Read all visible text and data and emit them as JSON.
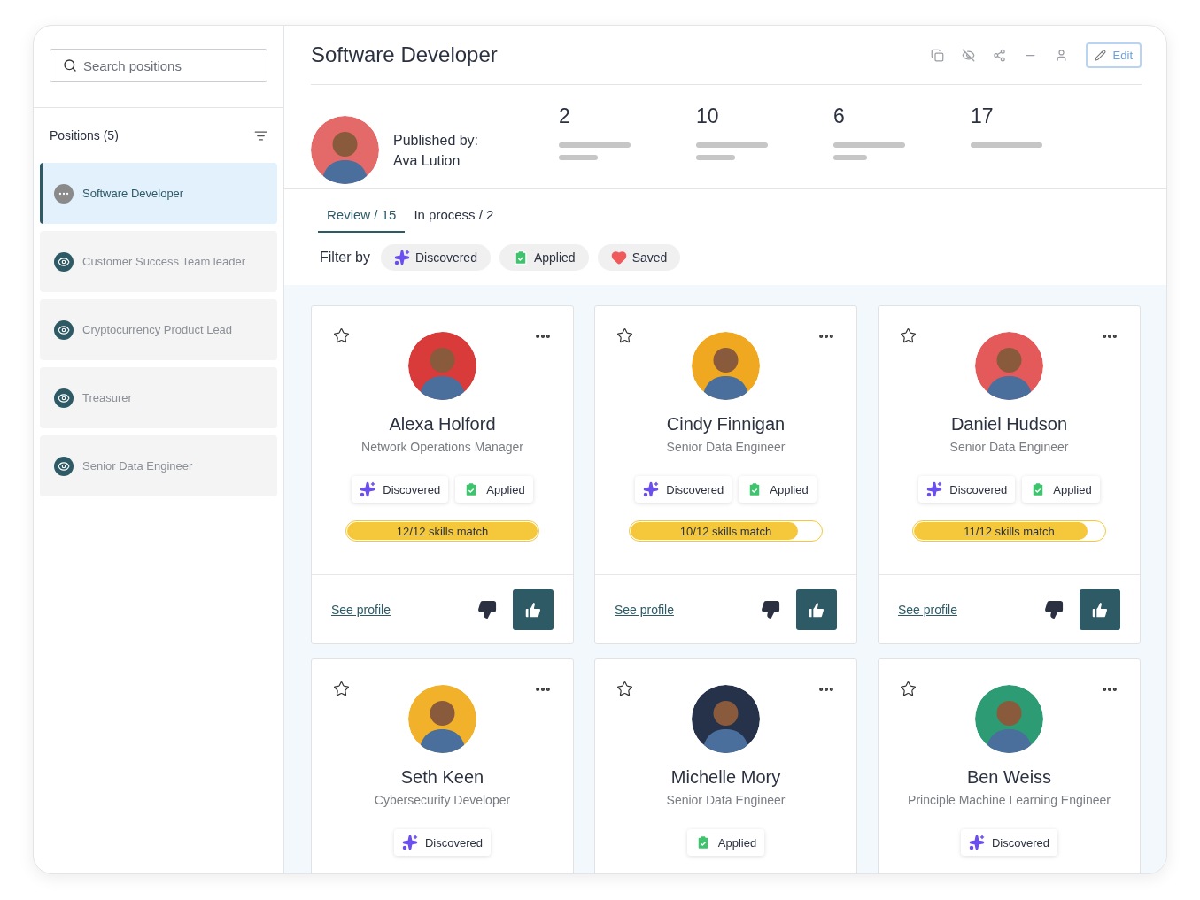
{
  "sidebar": {
    "search": {
      "placeholder": "Search positions"
    },
    "header": "Positions (5)",
    "items": [
      {
        "label": "Software Developer",
        "selected": true
      },
      {
        "label": "Customer Success Team leader",
        "selected": false
      },
      {
        "label": "Cryptocurrency Product Lead",
        "selected": false
      },
      {
        "label": "Treasurer",
        "selected": false
      },
      {
        "label": "Senior Data Engineer",
        "selected": false
      }
    ]
  },
  "header": {
    "title": "Software Developer",
    "edit_button": "Edit"
  },
  "publisher": {
    "label": "Published by:",
    "name": "Ava Lution"
  },
  "stats": [
    "2",
    "10",
    "6",
    "17"
  ],
  "tabs": [
    {
      "label": "Review / 15",
      "selected": true
    },
    {
      "label": "In process / 2",
      "selected": false
    }
  ],
  "filter": {
    "label": "Filter by",
    "chips": [
      {
        "kind": "discovered",
        "label": "Discovered"
      },
      {
        "kind": "applied",
        "label": "Applied"
      },
      {
        "kind": "saved",
        "label": "Saved"
      }
    ]
  },
  "candidates": [
    {
      "name": "Alexa Holford",
      "role": "Network Operations Manager",
      "color": "#d93a3a",
      "tags": [
        {
          "kind": "discovered",
          "label": "Discovered"
        },
        {
          "kind": "applied",
          "label": "Applied"
        }
      ],
      "match": "12/12 skills match",
      "level": 1,
      "link": "See profile"
    },
    {
      "name": "Cindy Finnigan",
      "role": "Senior Data Engineer",
      "color": "#f0a821",
      "tags": [
        {
          "kind": "discovered",
          "label": "Discovered"
        },
        {
          "kind": "applied",
          "label": "Applied"
        }
      ],
      "match": "10/12 skills match",
      "level": 0.88,
      "link": "See profile"
    },
    {
      "name": "Daniel Hudson",
      "role": "Senior Data Engineer",
      "color": "#e45a5a",
      "tags": [
        {
          "kind": "discovered",
          "label": "Discovered"
        },
        {
          "kind": "applied",
          "label": "Applied"
        }
      ],
      "match": "11/12 skills match",
      "level": 0.91,
      "link": "See profile"
    },
    {
      "name": "Seth Keen",
      "role": "Cybersecurity Developer",
      "color": "#f2b12a",
      "tags": [
        {
          "kind": "discovered",
          "label": "Discovered"
        }
      ]
    },
    {
      "name": "Michelle Mory",
      "role": "Senior Data Engineer",
      "color": "#25324a",
      "tags": [
        {
          "kind": "applied",
          "label": "Applied"
        }
      ]
    },
    {
      "name": "Ben Weiss",
      "role": "Principle Machine Learning Engineer",
      "color": "#2d9b73",
      "tags": [
        {
          "kind": "discovered",
          "label": "Discovered"
        }
      ]
    }
  ]
}
